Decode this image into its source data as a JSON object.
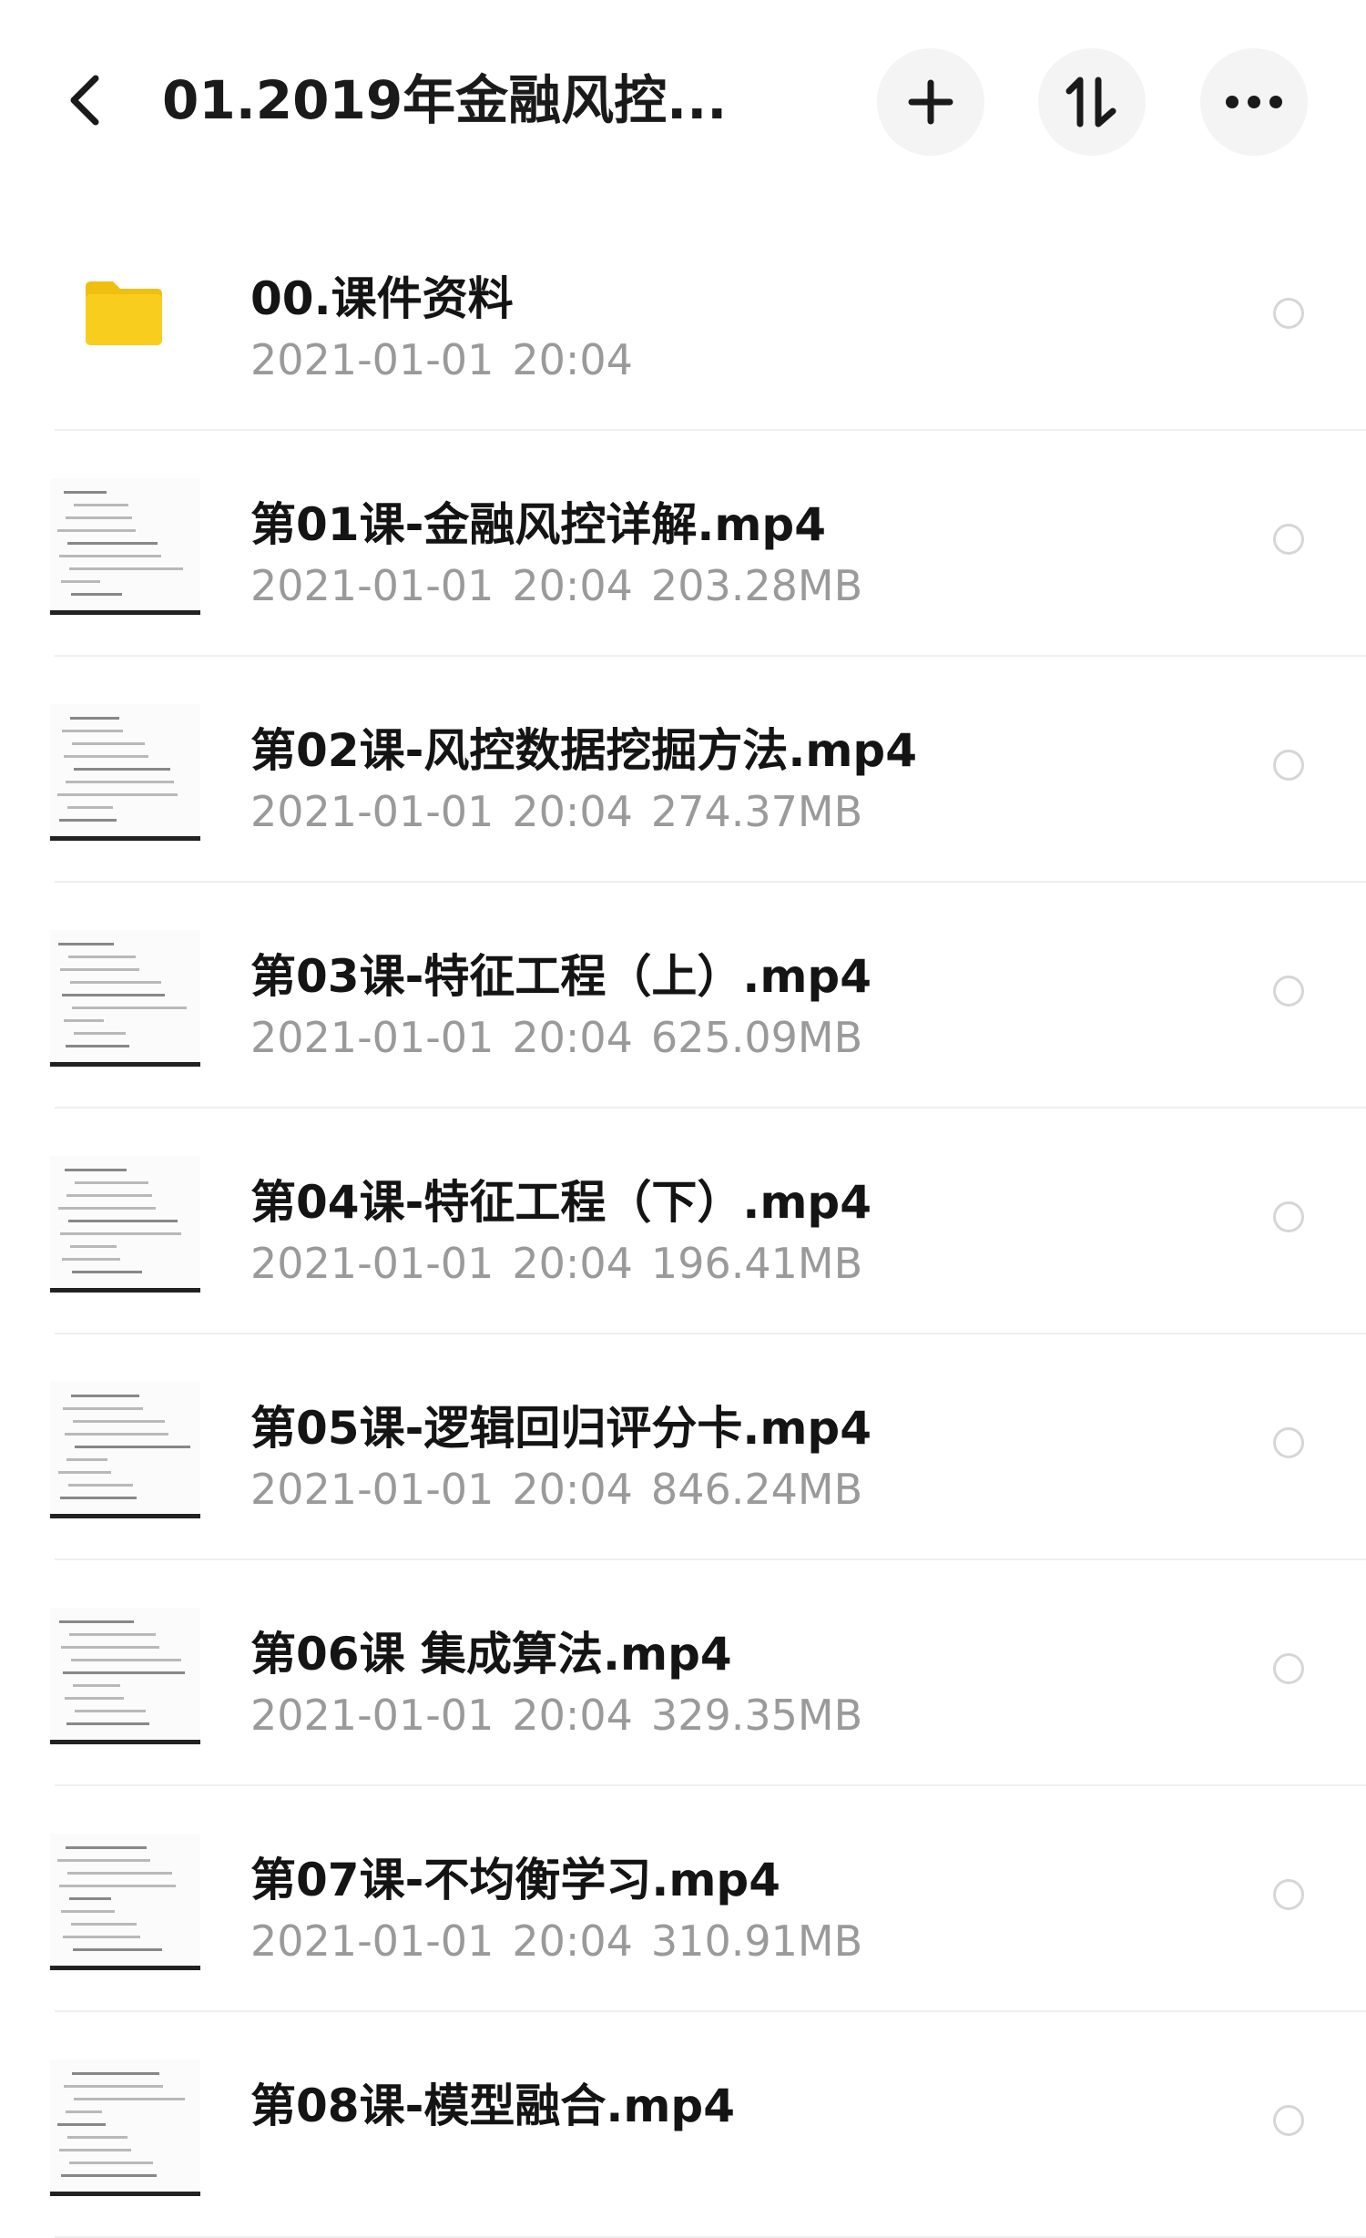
{
  "header": {
    "title": "01.2019年金融风控...",
    "back_icon": "chevron-left-icon",
    "actions": [
      {
        "name": "add-button",
        "icon": "plus-icon"
      },
      {
        "name": "sort-button",
        "icon": "sort-icon"
      },
      {
        "name": "more-button",
        "icon": "ellipsis-icon"
      }
    ]
  },
  "files": [
    {
      "type": "folder",
      "name": "00.课件资料",
      "date": "2021-01-01",
      "time": "20:04",
      "size": ""
    },
    {
      "type": "video",
      "name": "第01课-金融风控详解.mp4",
      "date": "2021-01-01",
      "time": "20:04",
      "size": "203.28MB"
    },
    {
      "type": "video",
      "name": "第02课-风控数据挖掘方法.mp4",
      "date": "2021-01-01",
      "time": "20:04",
      "size": "274.37MB"
    },
    {
      "type": "video",
      "name": "第03课-特征工程（上）.mp4",
      "date": "2021-01-01",
      "time": "20:04",
      "size": "625.09MB"
    },
    {
      "type": "video",
      "name": "第04课-特征工程（下）.mp4",
      "date": "2021-01-01",
      "time": "20:04",
      "size": "196.41MB"
    },
    {
      "type": "video",
      "name": "第05课-逻辑回归评分卡.mp4",
      "date": "2021-01-01",
      "time": "20:04",
      "size": "846.24MB"
    },
    {
      "type": "video",
      "name": "第06课 集成算法.mp4",
      "date": "2021-01-01",
      "time": "20:04",
      "size": "329.35MB"
    },
    {
      "type": "video",
      "name": "第07课-不均衡学习.mp4",
      "date": "2021-01-01",
      "time": "20:04",
      "size": "310.91MB"
    },
    {
      "type": "video",
      "name": "第08课-模型融合.mp4",
      "date": "",
      "time": "",
      "size": ""
    }
  ],
  "colors": {
    "folder": "#f9cd1e",
    "folder_dark": "#f0bf10",
    "meta_text": "#9a9a9a",
    "button_bg": "#f4f4f4"
  }
}
